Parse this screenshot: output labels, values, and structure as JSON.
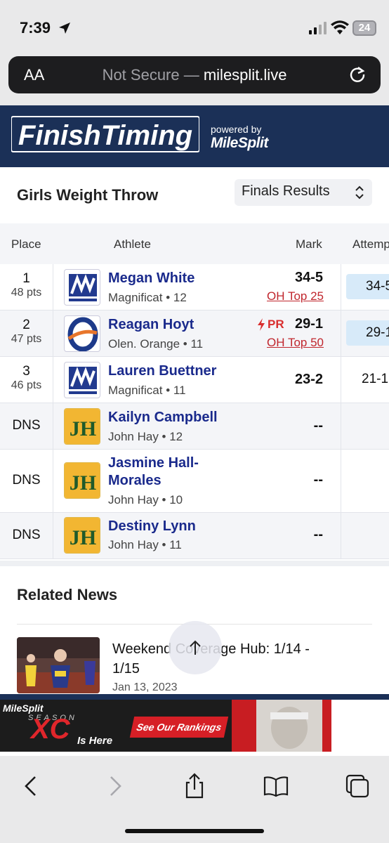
{
  "status": {
    "time": "7:39",
    "battery": "24"
  },
  "browser": {
    "aa_label": "AA",
    "url_prefix": "Not Secure — ",
    "url_domain": "milesplit.live"
  },
  "banner": {
    "logo_text": "FinishTiming",
    "powered_by": "powered by",
    "milesplit": "MileSplit"
  },
  "event": {
    "title": "Girls Weight Throw",
    "select_value": "Finals Results"
  },
  "table": {
    "headers": {
      "place": "Place",
      "athlete": "Athlete",
      "mark": "Mark",
      "attempts": "Attemp"
    },
    "rows": [
      {
        "place": "1",
        "pts": "48 pts",
        "name": "Megan White",
        "team": "Magnificat • 12",
        "mark": "34-5",
        "sub": "OH Top 25",
        "pr": "",
        "attempt": "34-5",
        "logo": "magnificat"
      },
      {
        "place": "2",
        "pts": "47 pts",
        "name": "Reagan Hoyt",
        "team": "Olen. Orange • 11",
        "mark": "29-1",
        "sub": "OH Top 50",
        "pr": "PR",
        "attempt": "29-1",
        "logo": "orange"
      },
      {
        "place": "3",
        "pts": "46 pts",
        "name": "Lauren Buettner",
        "team": "Magnificat • 11",
        "mark": "23-2",
        "sub": "",
        "pr": "",
        "attempt": "21-1",
        "logo": "magnificat"
      },
      {
        "place": "DNS",
        "pts": "",
        "name": "Kailyn Campbell",
        "team": "John Hay • 12",
        "mark": "--",
        "sub": "",
        "pr": "",
        "attempt": "",
        "logo": "johnhay"
      },
      {
        "place": "DNS",
        "pts": "",
        "name": "Jasmine Hall-Morales",
        "name_line1": "Jasmine Hall-",
        "name_line2": "Morales",
        "team": "John Hay • 10",
        "mark": "--",
        "sub": "",
        "pr": "",
        "attempt": "",
        "logo": "johnhay"
      },
      {
        "place": "DNS",
        "pts": "",
        "name": "Destiny Lynn",
        "team": "John Hay • 11",
        "mark": "--",
        "sub": "",
        "pr": "",
        "attempt": "",
        "logo": "johnhay"
      }
    ]
  },
  "news": {
    "heading": "Related News",
    "items": [
      {
        "title": "Weekend Coverage Hub: 1/14 - 1/15",
        "title_line1": "Weekend Coverage Hub: 1/14 -",
        "title_line2": "1/15",
        "date": "Jan 13, 2023"
      }
    ]
  },
  "ad": {
    "brand": "MileSplit",
    "season": "SEASON",
    "xc": "XC",
    "is_here": "Is Here",
    "cta": "See Our Rankings"
  },
  "colors": {
    "navy": "#1b3057",
    "link": "#1a2a8c",
    "red": "#c0262d",
    "pill": "#d7eaf9"
  }
}
